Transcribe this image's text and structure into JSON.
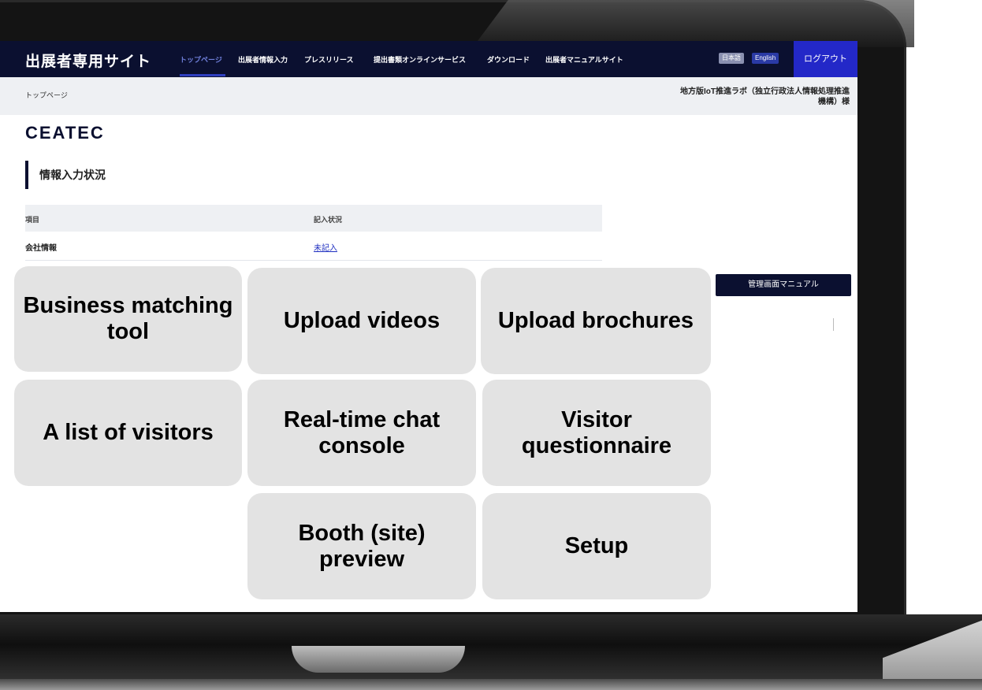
{
  "header": {
    "site_title": "出展者専用サイト",
    "nav": [
      "トップページ",
      "出展者情報入力",
      "プレスリリース",
      "提出書類オンラインサービス",
      "ダウンロード",
      "出展者マニュアルサイト"
    ],
    "lang_ja": "日本語",
    "lang_en": "English",
    "logout": "ログアウト"
  },
  "subbar": {
    "breadcrumb": "トップページ",
    "organization": "地方版IoT推進ラボ（独立行政法人情報処理推進機構）様"
  },
  "logo": "CEATEC",
  "section_title": "情報入力状況",
  "table": {
    "headers": [
      "項目",
      "記入状況"
    ],
    "rows": [
      {
        "item": "会社情報",
        "status": "未記入"
      }
    ]
  },
  "manual_button": "管理画面マニュアル",
  "tiles": [
    "Business matching tool",
    "Upload videos",
    "Upload brochures",
    "A list of visitors",
    "Real-time chat console",
    "Visitor questionnaire",
    "Booth (site) preview",
    "Setup"
  ],
  "colors": {
    "nav_bg": "#0b1030",
    "accent": "#2328c8",
    "tile_bg": "#e3e3e3"
  }
}
